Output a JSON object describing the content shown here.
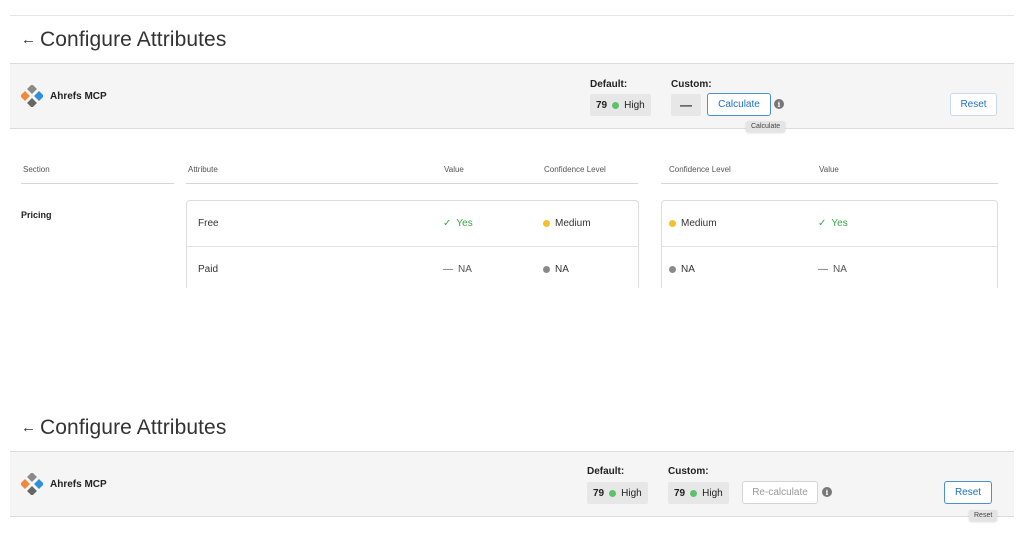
{
  "top_panel": {
    "title": "Configure Attributes",
    "back_icon": "←",
    "app_name": "Ahrefs MCP",
    "default_label": "Default:",
    "default_score": "79",
    "default_level": "High",
    "custom_label": "Custom:",
    "custom_value": "—",
    "calculate_label": "Calculate",
    "info_icon": "i",
    "tooltip_calculate": "Calculate",
    "reset_label": "Reset"
  },
  "table": {
    "headers": {
      "section": "Section",
      "attribute": "Attribute",
      "value": "Value",
      "confidence": "Confidence Level",
      "custom_confidence": "Confidence Level",
      "custom_value": "Value"
    },
    "section_name": "Pricing",
    "rows": [
      {
        "attribute": "Free",
        "value": "Yes",
        "confidence": "Medium",
        "custom_confidence": "Medium",
        "custom_value": "Yes"
      },
      {
        "attribute": "Paid",
        "value": "NA",
        "confidence": "NA",
        "custom_confidence": "NA",
        "custom_value": "NA"
      }
    ],
    "check_glyph": "✓",
    "dash_glyph": "—"
  },
  "bottom_panel": {
    "title": "Configure Attributes",
    "back_icon": "←",
    "app_name": "Ahrefs MCP",
    "default_label": "Default:",
    "default_score": "79",
    "default_level": "High",
    "custom_label": "Custom:",
    "custom_score": "79",
    "custom_level": "High",
    "recalculate_label": "Re-calculate",
    "info_icon": "i",
    "reset_label": "Reset",
    "tooltip_reset": "Reset"
  },
  "colors": {
    "accent": "#1f6fc5",
    "high": "#5cc26a",
    "medium": "#f2c12e",
    "na": "#8a8a8a",
    "yes": "#3aa54b"
  }
}
